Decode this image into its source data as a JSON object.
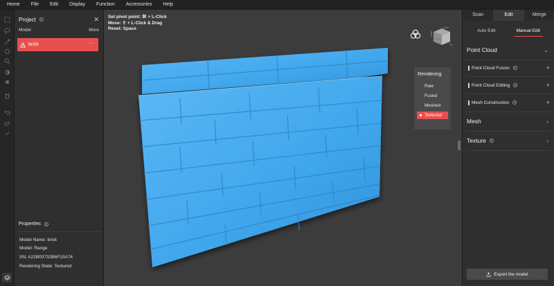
{
  "menu": [
    "Home",
    "File",
    "Edit",
    "Display",
    "Function",
    "Accessories",
    "Help"
  ],
  "left_panel": {
    "title": "Project",
    "model_header": "Model",
    "more_label": "More",
    "model_item": {
      "name": "brick",
      "more": "···"
    },
    "properties": {
      "title": "Properties",
      "lines": [
        "Model Name:  brick",
        "Model:  Range",
        "SN:  A22B00732B6F10A74",
        "Rendering State:  Textured"
      ]
    }
  },
  "viewport": {
    "hints": [
      "Set pivot point: ⌘ + L-Click",
      "Move: ⇧ + L-Click & Drag",
      "Reset: Space"
    ],
    "nav_cube_label": "Front",
    "rendering": {
      "title": "Rendering",
      "options": [
        "Raw",
        "Fused",
        "Meshed",
        "Textured"
      ],
      "selected": "Textured"
    },
    "scan_color": "#43a9ef"
  },
  "right_panel": {
    "tabs": [
      "Scan",
      "Edit",
      "Merge"
    ],
    "active_tab": "Edit",
    "subtabs": [
      "Auto Edit",
      "Manual Edit"
    ],
    "active_subtab": "Manual Edit",
    "point_cloud": {
      "title": "Point Cloud",
      "items": [
        "Point Cloud Fusion",
        "Point Cloud Editing",
        "Mesh Construction"
      ]
    },
    "mesh_title": "Mesh",
    "texture_title": "Texture",
    "export_label": "Export the model"
  },
  "colors": {
    "accent": "#e8504f",
    "panel": "#2f2f2f",
    "viewport": "#3c3c3c"
  }
}
